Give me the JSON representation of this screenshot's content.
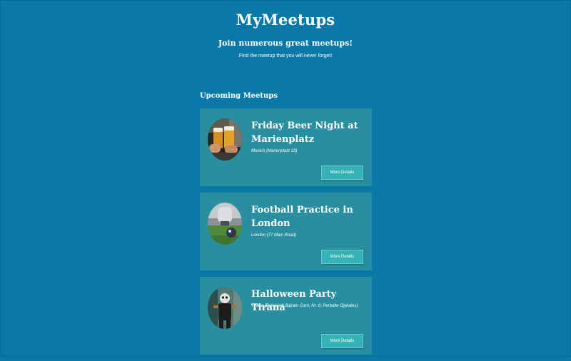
{
  "header": {
    "title": "MyMeetups",
    "subtitle": "Join numerous great meetups!",
    "tagline": "Find the meetup that you will never forget!"
  },
  "section": {
    "title": "Upcoming Meetups"
  },
  "meetups": [
    {
      "title": "Friday Beer Night at Marienplatz",
      "address": "Munich (Marienplatz 23)",
      "button_label": "More Details",
      "image": "beer-glasses-photo"
    },
    {
      "title": "Football Practice in London",
      "address": "London (77 Main Road)",
      "button_label": "More Details",
      "image": "football-field-photo"
    },
    {
      "title": "Halloween Party Tirana",
      "address": "Tirana (Bulevardi Bajram Curri, Nr. 8, Perballe Gjykates)",
      "button_label": "More Details",
      "image": "halloween-costume-photo"
    }
  ],
  "colors": {
    "background": "#0a79a8",
    "card": "#288fa0",
    "button": "#35b2b5",
    "text": "#ffffff"
  }
}
